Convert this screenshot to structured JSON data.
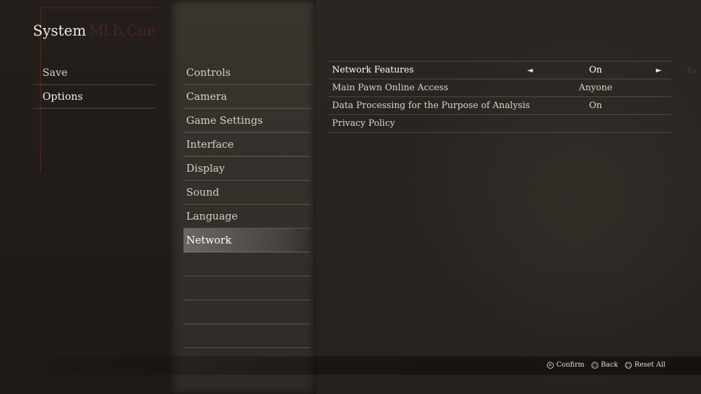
{
  "header": {
    "title": "System",
    "title_faded": "Ml.b.Cue"
  },
  "left_menu": {
    "items": [
      {
        "label": "Save"
      },
      {
        "label": "Options"
      }
    ]
  },
  "mid_menu": {
    "items": [
      {
        "label": "Controls"
      },
      {
        "label": "Camera"
      },
      {
        "label": "Game Settings"
      },
      {
        "label": "Interface"
      },
      {
        "label": "Display"
      },
      {
        "label": "Sound"
      },
      {
        "label": "Language"
      },
      {
        "label": "Network"
      }
    ]
  },
  "settings": {
    "rows": [
      {
        "label": "Network Features",
        "value": "On"
      },
      {
        "label": "Main Pawn Online Access",
        "value": "Anyone"
      },
      {
        "label": "Data Processing for the Purpose of Analysis",
        "value": "On"
      },
      {
        "label": "Privacy Policy",
        "value": ""
      }
    ]
  },
  "ghost_text": "Tu",
  "footer": {
    "confirm": "Confirm",
    "back": "Back",
    "reset": "Reset All"
  },
  "icons": {
    "left_arrow": "◄",
    "right_arrow": "►",
    "cross": "✕",
    "circle": "○",
    "square": "□"
  }
}
